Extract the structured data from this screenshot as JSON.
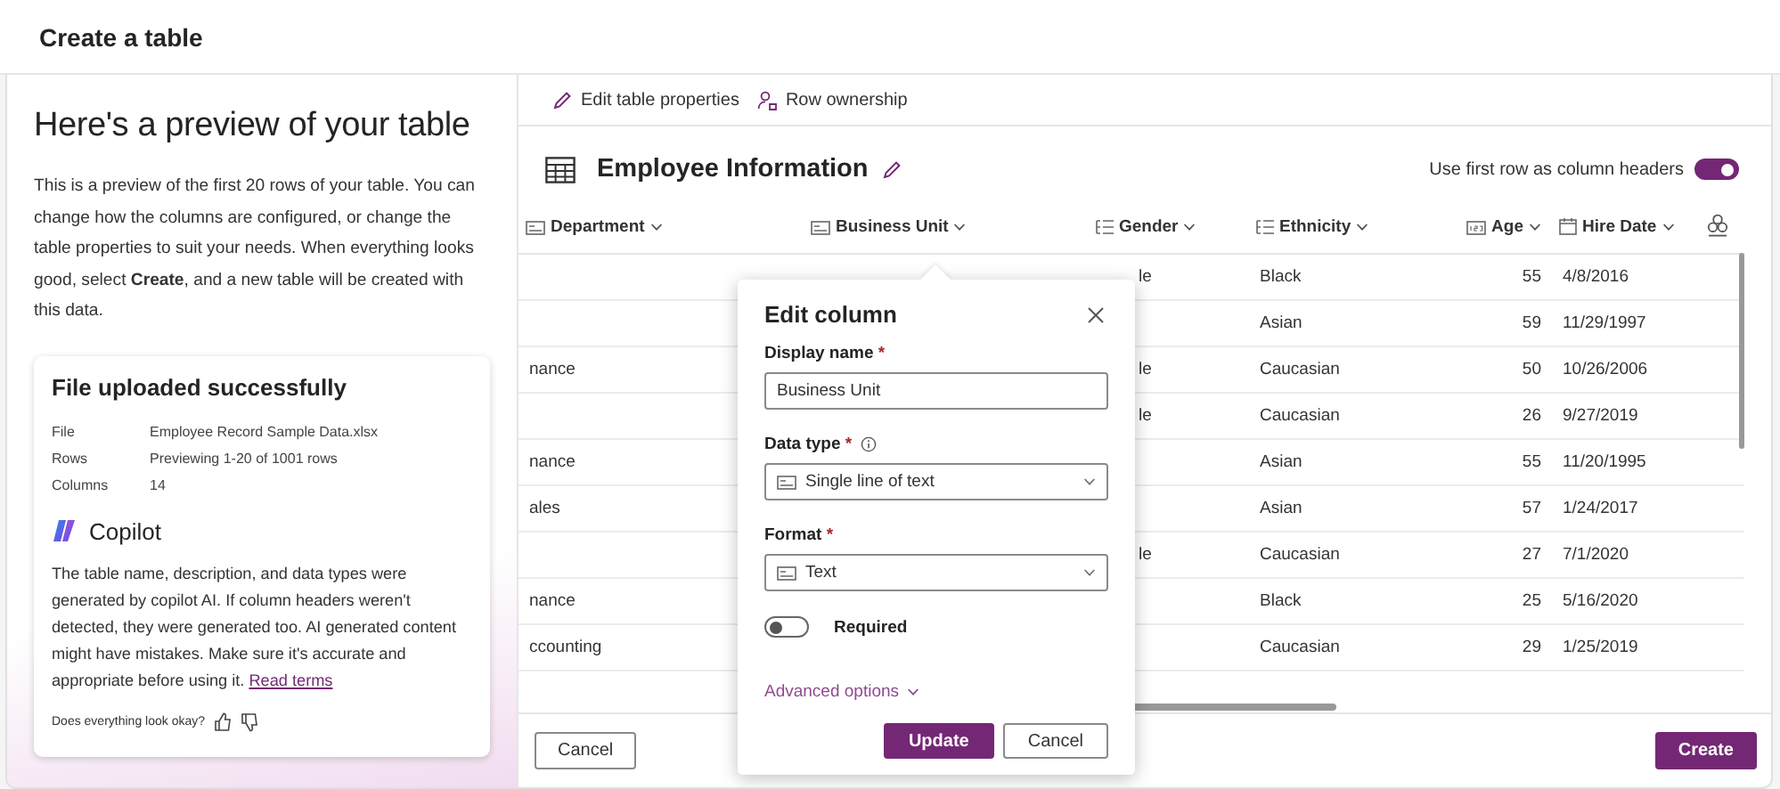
{
  "window": {
    "title": "Create a table"
  },
  "intro": {
    "heading": "Here's a preview of your table",
    "description": "This is a preview of the first 20 rows of your table. You can change how the columns are configured, or change the table properties to suit your needs. When everything looks good, select **Create**, and a new table will be created with this data."
  },
  "upload_card": {
    "title": "File uploaded successfully",
    "details": [
      {
        "label": "File",
        "value": "Employee Record Sample Data.xlsx"
      },
      {
        "label": "Rows",
        "value": "Previewing 1-20 of 1001 rows"
      },
      {
        "label": "Columns",
        "value": "14"
      }
    ],
    "copilot": {
      "title": "Copilot",
      "text": "The table name, description, and data types were generated by copilot AI. If column headers weren't detected, they were generated too. AI generated content might have mistakes. Make sure it's accurate and appropriate before using it.",
      "link": "Read terms"
    },
    "feedback": {
      "prompt": "Does everything look okay?"
    }
  },
  "toolbar": [
    {
      "label": "Edit table properties",
      "kind": "edit"
    },
    {
      "label": "Row ownership",
      "kind": "ownership"
    }
  ],
  "table": {
    "name": "Employee Information",
    "header_toggle": {
      "label": "Use first row as column headers",
      "on": true
    },
    "columns": [
      {
        "label": "Department",
        "kind": "text"
      },
      {
        "label": "Business Unit",
        "kind": "text"
      },
      {
        "label": "Gender",
        "kind": "choice"
      },
      {
        "label": "Ethnicity",
        "kind": "choice"
      },
      {
        "label": "Age",
        "kind": "number"
      },
      {
        "label": "Hire Date",
        "kind": "date"
      },
      {
        "kind": "copilot"
      }
    ],
    "rows": [
      {
        "cells": [
          null,
          null,
          "le",
          "Black",
          "55",
          "4/8/2016"
        ]
      },
      {
        "cells": [
          null,
          null,
          null,
          "Asian",
          "59",
          "11/29/1997"
        ]
      },
      {
        "cells": [
          "nance",
          null,
          "le",
          "Caucasian",
          "50",
          "10/26/2006"
        ]
      },
      {
        "cells": [
          null,
          null,
          "le",
          "Caucasian",
          "26",
          "9/27/2019"
        ]
      },
      {
        "cells": [
          "nance",
          null,
          null,
          "Asian",
          "55",
          "11/20/1995"
        ]
      },
      {
        "cells": [
          "ales",
          null,
          null,
          "Asian",
          "57",
          "1/24/2017"
        ]
      },
      {
        "cells": [
          null,
          null,
          "le",
          "Caucasian",
          "27",
          "7/1/2020"
        ]
      },
      {
        "cells": [
          "nance",
          null,
          null,
          "Black",
          "25",
          "5/16/2020"
        ]
      },
      {
        "cells": [
          "ccounting",
          null,
          null,
          "Caucasian",
          "29",
          "1/25/2019"
        ]
      }
    ]
  },
  "edit_column": {
    "title": "Edit column",
    "fields": [
      {
        "label": "Display name",
        "required_mark": "*",
        "kind": "input",
        "value": "Business Unit"
      },
      {
        "label": "Data type",
        "required_mark": "*",
        "info": true,
        "kind": "select",
        "value": "Single line of text"
      },
      {
        "label": "Format",
        "required_mark": "*",
        "kind": "select",
        "value": "Text"
      }
    ],
    "required_toggle": {
      "label": "Required",
      "on": false
    },
    "advanced": "Advanced options",
    "buttons": [
      {
        "label": "Update",
        "primary": true
      },
      {
        "label": "Cancel",
        "primary": false
      }
    ]
  },
  "footer": {
    "buttons": [
      {
        "label": "Cancel",
        "primary": false
      },
      {
        "label": "Create",
        "primary": true
      }
    ]
  }
}
